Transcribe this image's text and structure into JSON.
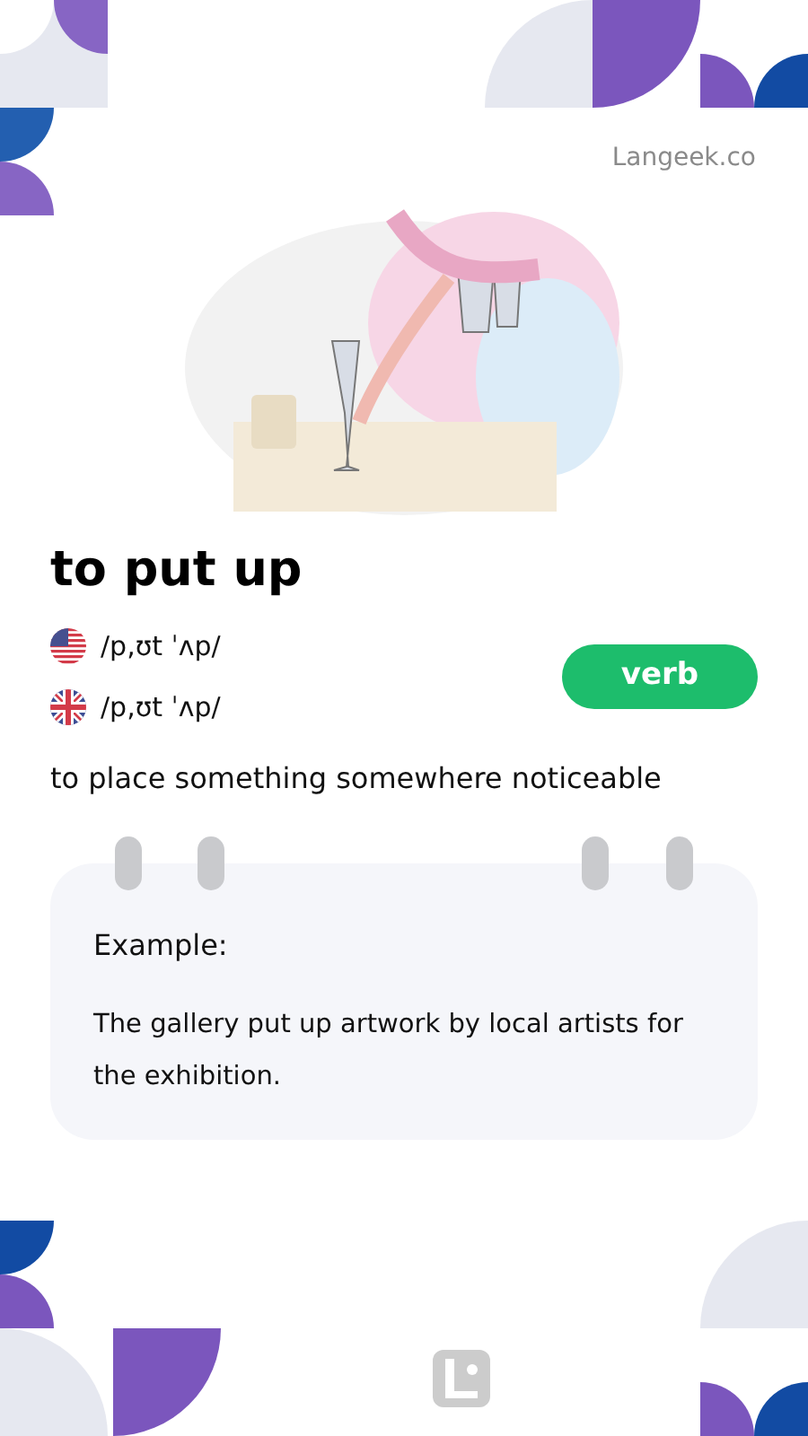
{
  "site": "Langeek.co",
  "word": "to put up",
  "pronunciations": [
    {
      "kind": "us",
      "ipa": "/p,ʊt ˈʌp/"
    },
    {
      "kind": "uk",
      "ipa": "/p,ʊt ˈʌp/"
    }
  ],
  "part_of_speech": "verb",
  "definition": "to place something somewhere noticeable",
  "example": {
    "label": "Example:",
    "sentence": "The gallery put up artwork by local artists for the exhibition."
  }
}
